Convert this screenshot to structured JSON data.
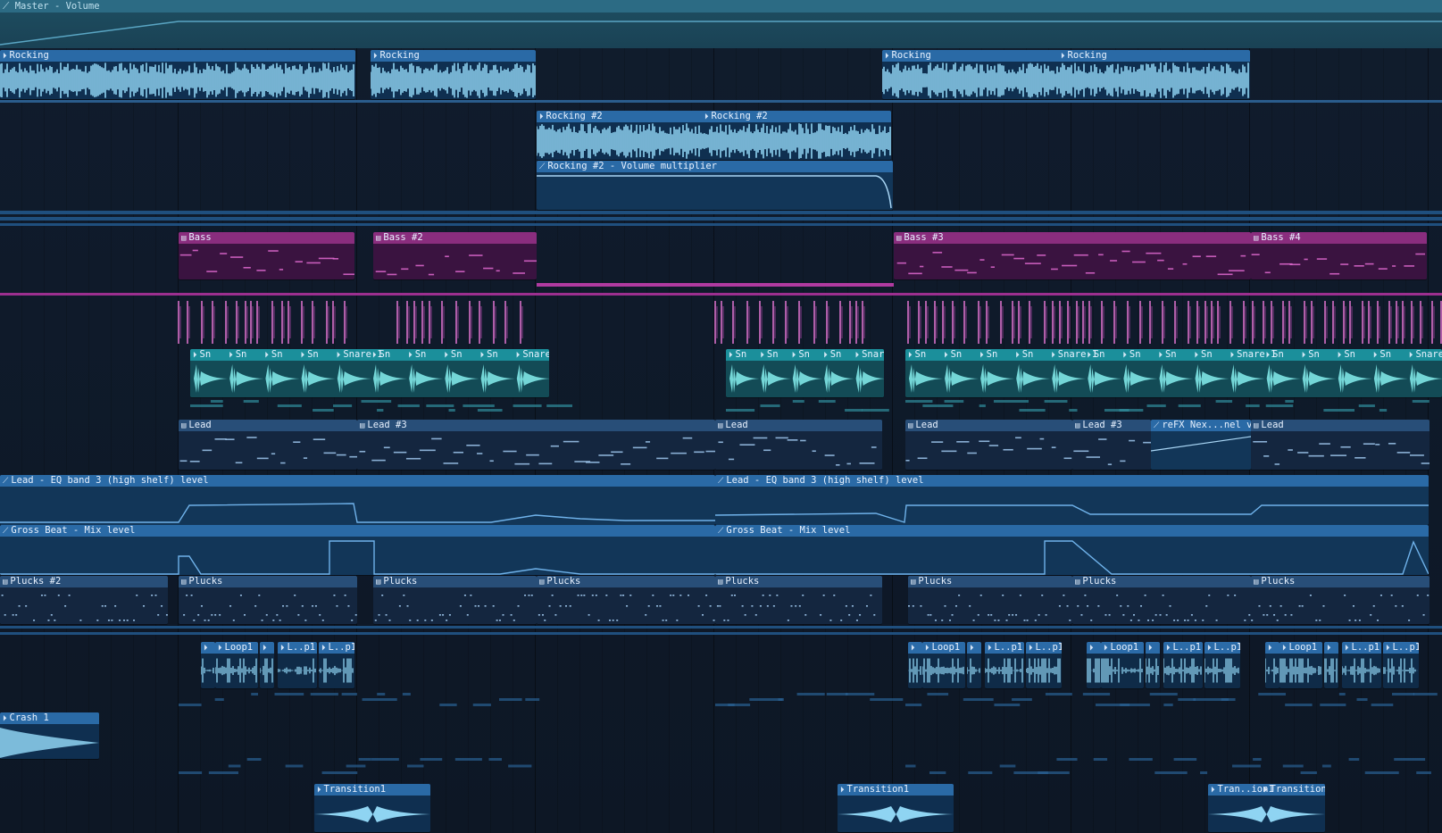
{
  "colors": {
    "background": "#0e1827",
    "audio_header": "#2a6aa6",
    "audio_wave": "#8fd4f2",
    "bass_header": "#8a2d7e",
    "bass_note": "#e06ad0",
    "teal_header": "#1b8f9b",
    "teal_wave": "#7fe6e6",
    "automation_line": "#6fb2ea",
    "pattern_note": "#9fc8ee"
  },
  "master_automation": {
    "label": "Master - Volume",
    "icon": "automation-icon"
  },
  "tracks": {
    "rocking": [
      {
        "label": "Rocking",
        "icon": "audio-clip-icon"
      },
      {
        "label": "Rocking",
        "icon": "audio-clip-icon"
      },
      {
        "label": "Rocking",
        "icon": "audio-clip-icon"
      },
      {
        "label": "Rocking",
        "icon": "audio-clip-icon"
      }
    ],
    "rocking2": [
      {
        "label": "Rocking #2",
        "icon": "audio-clip-icon"
      },
      {
        "label": "Rocking #2",
        "icon": "audio-clip-icon"
      }
    ],
    "rocking2_auto": {
      "label": "Rocking #2 - Volume multiplier",
      "icon": "automation-icon"
    },
    "bass": [
      {
        "label": "Bass",
        "icon": "pattern-icon"
      },
      {
        "label": "Bass #2",
        "icon": "pattern-icon"
      },
      {
        "label": "Bass #3",
        "icon": "pattern-icon"
      },
      {
        "label": "Bass #4",
        "icon": "pattern-icon"
      }
    ],
    "snare_labels": [
      "Sn",
      "Snare 1",
      "Snare"
    ],
    "lead": [
      {
        "label": "Lead"
      },
      {
        "label": "Lead #3"
      },
      {
        "label": "Lead"
      },
      {
        "label": "Lead"
      },
      {
        "label": "Lead #3"
      },
      {
        "label": "reFX Nex...nel volume"
      },
      {
        "label": "Lead"
      }
    ],
    "eq_auto": [
      {
        "label": "Lead - EQ band 3 (high shelf) level"
      },
      {
        "label": "Lead - EQ band 3 (high shelf) level"
      }
    ],
    "gross_auto": [
      {
        "label": "Gross Beat - Mix level"
      },
      {
        "label": "Gross Beat - Mix level"
      }
    ],
    "plucks": [
      {
        "label": "Plucks #2"
      },
      {
        "label": "Plucks"
      },
      {
        "label": "Plucks"
      },
      {
        "label": "Plucks"
      },
      {
        "label": "Plucks"
      },
      {
        "label": "Plucks"
      },
      {
        "label": "Plucks"
      },
      {
        "label": "Plucks"
      }
    ],
    "loop_labels": [
      "Loop1",
      "L..p1"
    ],
    "crash": {
      "label": "Crash 1"
    },
    "transitions": [
      {
        "label": "Transition1"
      },
      {
        "label": "Transition1"
      },
      {
        "label": "Tran..ion1"
      },
      {
        "label": "Transition1"
      }
    ]
  }
}
